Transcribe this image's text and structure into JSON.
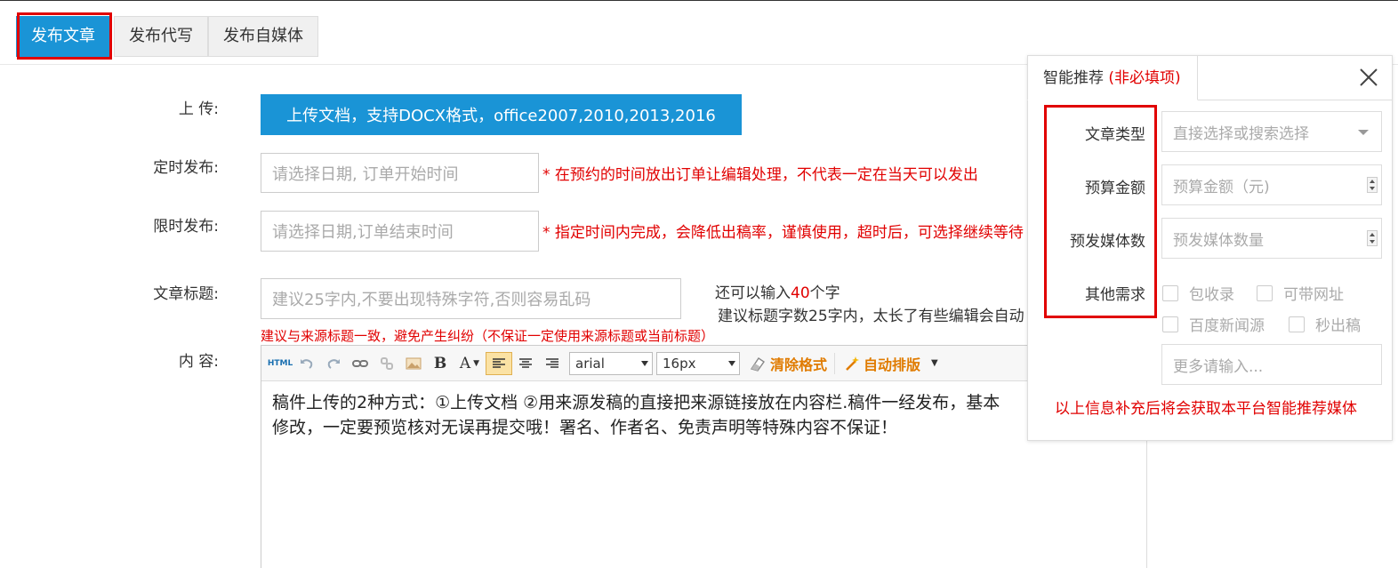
{
  "tabs": [
    {
      "label": "发布文章",
      "active": true
    },
    {
      "label": "发布代写",
      "active": false
    },
    {
      "label": "发布自媒体",
      "active": false
    }
  ],
  "form": {
    "upload_label": "上 传:",
    "upload_button": "上传文档，支持DOCX格式，office2007,2010,2013,2016",
    "schedule_label": "定时发布:",
    "schedule_placeholder": "请选择日期, 订单开始时间",
    "schedule_note": "* 在预约的时间放出订单让编辑处理，不代表一定在当天可以发出",
    "limit_label": "限时发布:",
    "limit_placeholder": "请选择日期,订单结束时间",
    "limit_note": "* 指定时间内完成，会降低出稿率，谨慎使用，超时后，可选择继续等待",
    "title_label": "文章标题:",
    "title_placeholder": "建议25字内,不要出现特殊字符,否则容易乱码",
    "counter_prefix": "还可以输入",
    "counter_num": "40",
    "counter_suffix": "个字",
    "title_hint": "建议标题字数25字内，太长了有些编辑会自动",
    "title_note": "建议与来源标题一致，避免产生纠纷（不保证一定使用来源标题或当前标题）",
    "content_label": "内 容:"
  },
  "editor": {
    "html_btn": "HTML",
    "font_family": "arial",
    "font_size": "16px",
    "clear_format": "清除格式",
    "auto_layout": "自动排版",
    "content_line1": "稿件上传的2种方式：①上传文档 ②用来源发稿的直接把来源链接放在内容栏.稿件一经发布，基本",
    "content_line2": "修改，一定要预览核对无误再提交哦！署名、作者名、免责声明等特殊内容不保证！"
  },
  "panel": {
    "title": "智能推荐",
    "optional": "(非必填项)",
    "type_label": "文章类型",
    "type_placeholder": "直接选择或搜索选择",
    "budget_label": "预算金额",
    "budget_placeholder": "预算金额（元)",
    "media_label": "预发媒体数",
    "media_placeholder": "预发媒体数量",
    "other_label": "其他需求",
    "options": [
      "包收录",
      "可带网址",
      "百度新闻源",
      "秒出稿"
    ],
    "more_placeholder": "更多请输入...",
    "footer": "以上信息补充后将会获取本平台智能推荐媒体"
  },
  "colors": {
    "accent": "#1a94d6",
    "warning": "#e10000",
    "highlight": "#e07b00"
  }
}
